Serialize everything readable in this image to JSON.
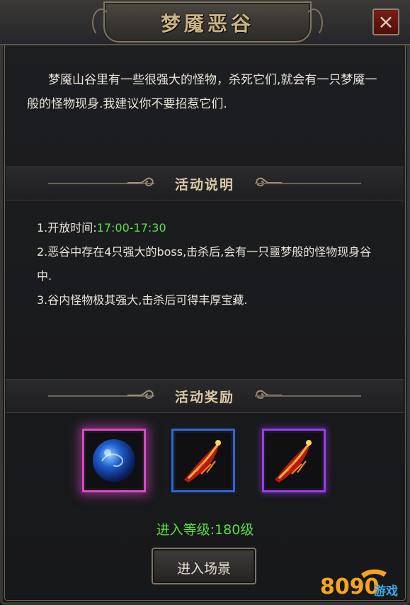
{
  "window": {
    "title": "梦魇恶谷",
    "close_label": "×"
  },
  "description": "梦魇山谷里有一些很强大的怪物，杀死它们,就会有一只梦魇一般的怪物现身.我建议你不要招惹它们.",
  "activity_section": {
    "title": "活动说明",
    "rule1_prefix": "1.开放时间:",
    "rule1_time": "17:00-17:30",
    "rule2": "2.恶谷中存在4只强大的boss,击杀后,会有一只噩梦般的怪物现身谷中.",
    "rule3": "3.谷内怪物极其强大,击杀后可得丰厚宝藏."
  },
  "reward_section": {
    "title": "活动奖励",
    "items": [
      {
        "icon": "blue-orb-icon",
        "border_color": "#e047c7"
      },
      {
        "icon": "red-wing-icon",
        "border_color": "#2d66e0"
      },
      {
        "icon": "red-wing-icon",
        "border_color": "#9a3bf0"
      }
    ]
  },
  "level_requirement": "进入等级:180级",
  "enter_button": "进入场景",
  "watermark": {
    "digits": "8090",
    "suffix": "游戏"
  },
  "colors": {
    "accent_gold": "#cbb483",
    "green_text": "#58de40",
    "close_red": "#7a1e17"
  }
}
